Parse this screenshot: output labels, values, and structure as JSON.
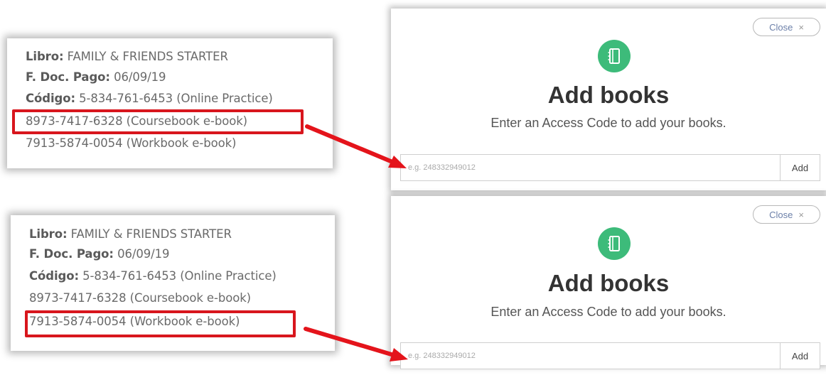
{
  "panels": [
    {
      "card": {
        "book_label": "Libro:",
        "book_value": " FAMILY & FRIENDS STARTER",
        "date_label": "F. Doc. Pago:",
        "date_value": " 06/09/19",
        "code_label": "Código:",
        "code_value": " 5-834-761-6453 (Online Practice)",
        "coursebook_code": "8973-7417-6328 (Coursebook e-book)",
        "workbook_code": "7913-5874-0054 (Workbook e-book)",
        "highlighted": "coursebook"
      },
      "modal": {
        "close_label": "Close",
        "close_icon": "×",
        "title": "Add books",
        "subtitle": "Enter an Access Code to add your books.",
        "input_placeholder": "e.g. 248332949012",
        "input_value": "",
        "add_label": "Add"
      }
    },
    {
      "card": {
        "book_label": "Libro:",
        "book_value": " FAMILY & FRIENDS STARTER",
        "date_label": "F. Doc. Pago:",
        "date_value": " 06/09/19",
        "code_label": "Código:",
        "code_value": " 5-834-761-6453 (Online Practice)",
        "coursebook_code": "8973-7417-6328 (Coursebook e-book)",
        "workbook_code": "7913-5874-0054 (Workbook e-book)",
        "highlighted": "workbook"
      },
      "modal": {
        "close_label": "Close",
        "close_icon": "×",
        "title": "Add books",
        "subtitle": "Enter an Access Code to add your books.",
        "input_placeholder": "e.g. 248332949012",
        "input_value": "",
        "add_label": "Add"
      }
    }
  ],
  "colors": {
    "highlight": "#d8161d",
    "arrow": "#e4141b",
    "icon_bg": "#3dbb7a",
    "close_text": "#6b7fa8"
  },
  "icons": {
    "book": "notebook-icon",
    "close": "close-icon",
    "arrow": "arrow-icon"
  }
}
